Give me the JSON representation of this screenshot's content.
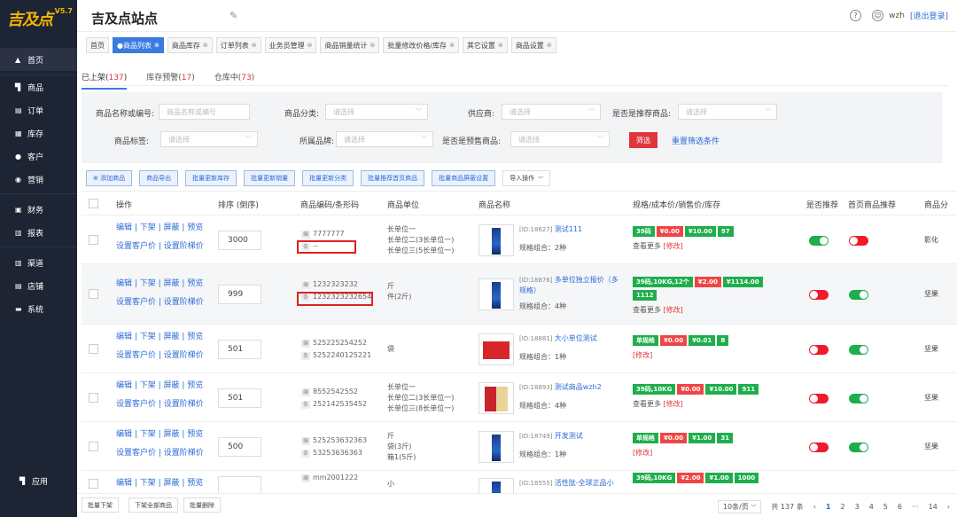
{
  "logo": {
    "text": "吉及点",
    "version": "V5.7"
  },
  "sidebar": {
    "group1": [
      {
        "icon": "home-icon",
        "glyph": "▲",
        "label": "首页"
      }
    ],
    "group2": [
      {
        "icon": "cart-icon",
        "glyph": "▜",
        "label": "商品"
      },
      {
        "icon": "order-icon",
        "glyph": "▤",
        "label": "订单"
      },
      {
        "icon": "stock-icon",
        "glyph": "▦",
        "label": "库存"
      },
      {
        "icon": "customer-icon",
        "glyph": "●",
        "label": "客户"
      },
      {
        "icon": "marketing-icon",
        "glyph": "◉",
        "label": "营销"
      }
    ],
    "group3": [
      {
        "icon": "finance-icon",
        "glyph": "▣",
        "label": "财务"
      },
      {
        "icon": "report-icon",
        "glyph": "▥",
        "label": "报表"
      }
    ],
    "group4": [
      {
        "icon": "channel-icon",
        "glyph": "▥",
        "label": "渠道"
      },
      {
        "icon": "shop-icon",
        "glyph": "▤",
        "label": "店铺"
      },
      {
        "icon": "system-icon",
        "glyph": "▬",
        "label": "系统"
      }
    ],
    "app": {
      "icon": "app-cart-icon",
      "glyph": "▜",
      "label": "应用"
    }
  },
  "header": {
    "title": "吉及点站点",
    "help": "?",
    "user": "wzh",
    "logout": "[退出登录]"
  },
  "tabs": [
    "首页",
    "商品列表",
    "商品库存",
    "订单列表",
    "业务员管理",
    "商品销量统计",
    "批量修改价格/库存",
    "其它设置",
    "商品设置"
  ],
  "status_tabs": [
    {
      "label": "已上架(",
      "count": "137",
      "end": ")"
    },
    {
      "label": "库存预警(",
      "count": "17",
      "end": ")"
    },
    {
      "label": "仓库中(",
      "count": "73",
      "end": ")"
    }
  ],
  "filter": {
    "name_label": "商品名称或编号:",
    "name_ph": "商品名称或编号",
    "cat_label": "商品分类:",
    "cat_ph": "请选择",
    "sup_label": "供应商:",
    "sup_ph": "请选择",
    "rec_label": "是否是推荐商品:",
    "rec_ph": "请选择",
    "tag_label": "商品标签:",
    "tag_ph": "请选择",
    "brand_label": "所属品牌:",
    "brand_ph": "请选择",
    "pre_label": "是否是预售商品:",
    "pre_ph": "请选择",
    "search": "筛选",
    "reset": "重置筛选条件"
  },
  "actions": [
    "添加商品",
    "商品导出",
    "批量更新库存",
    "批量更新销量",
    "批量更新分类",
    "批量推荐首页商品",
    "批量商品屏蔽设置",
    "导入操作"
  ],
  "columns": [
    "操作",
    "排序 (倒序)",
    "商品编码/条形码",
    "商品单位",
    "商品名称",
    "规格/成本价/销售价/库存",
    "是否推荐",
    "首页商品推荐",
    "商品分"
  ],
  "ops": {
    "line1": "编辑 | 下架 | 屏蔽 | 预览",
    "line2": "设置客户价 | 设置阶梯价"
  },
  "rows": [
    {
      "sort": "3000",
      "code": "7777777",
      "barcode": "--",
      "units": [
        "长单位一",
        "长单位二(3长单位一)",
        "长单位三(5长单位一)"
      ],
      "id": "[ID:18627]",
      "name": "测试111",
      "spec_count": "规格组合：2种",
      "pills": [
        [
          "39码",
          "g"
        ],
        [
          "¥0.00",
          "r"
        ],
        [
          "¥10.00",
          "g"
        ],
        [
          "97",
          "g"
        ]
      ],
      "more": "查看更多",
      "modify": "修改",
      "rec": true,
      "home": false,
      "cat": "影化"
    },
    {
      "sort": "999",
      "code": "1232323232",
      "barcode": "1232323232654",
      "units": [
        "斤",
        "件(2斤)"
      ],
      "id": "[ID:18876]",
      "name": "多单位独立报价（多规格）",
      "spec_count": "规格组合：4种",
      "pills": [
        [
          "39码,10KG,12个",
          "g"
        ],
        [
          "¥2.00",
          "r"
        ],
        [
          "¥1114.00",
          "g"
        ],
        [
          "1112",
          "g"
        ]
      ],
      "more": "查看更多",
      "modify": "修改",
      "rec": false,
      "home": true,
      "cat": "坚果"
    },
    {
      "sort": "501",
      "code": "525225254252",
      "barcode": "5252240125221",
      "units": [
        "袋"
      ],
      "id": "[ID:18881]",
      "name": "大小单位测试",
      "spec_count": "规格组合：1种",
      "pills": [
        [
          "单规格",
          "g"
        ],
        [
          "¥0.00",
          "r"
        ],
        [
          "¥0.01",
          "g"
        ],
        [
          "8",
          "g"
        ]
      ],
      "more": "",
      "modify": "修改",
      "rec": false,
      "home": true,
      "cat": "坚果"
    },
    {
      "sort": "501",
      "code": "8552542552",
      "barcode": "252142535452",
      "units": [
        "长单位一",
        "长单位二(3长单位一)",
        "长单位三(8长单位一)"
      ],
      "id": "[ID:18893]",
      "name": "测试商品wzh2",
      "spec_count": "规格组合：4种",
      "pills": [
        [
          "39码,10KG",
          "g"
        ],
        [
          "¥0.00",
          "r"
        ],
        [
          "¥10.00",
          "g"
        ],
        [
          "911",
          "g"
        ]
      ],
      "more": "查看更多",
      "modify": "修改",
      "rec": false,
      "home": true,
      "cat": "坚果"
    },
    {
      "sort": "500",
      "code": "525253632363",
      "barcode": "53253636363",
      "units": [
        "斤",
        "袋(3斤)",
        "箱1(5斤)"
      ],
      "id": "[ID:18749]",
      "name": "开发测试",
      "spec_count": "规格组合：1种",
      "pills": [
        [
          "单规格",
          "g"
        ],
        [
          "¥0.00",
          "r"
        ],
        [
          "¥1.00",
          "g"
        ],
        [
          "31",
          "g"
        ]
      ],
      "more": "",
      "modify": "修改",
      "rec": false,
      "home": true,
      "cat": "坚果"
    },
    {
      "sort": "",
      "code": "mm2001222",
      "barcode": "",
      "units": [
        "小"
      ],
      "id": "[ID:18555]",
      "name": "活性肽-全球正品小",
      "spec_count": "",
      "pills": [
        [
          "39码,10KG",
          "g"
        ],
        [
          "¥2.00",
          "r"
        ],
        [
          "¥1.00",
          "g"
        ],
        [
          "1000",
          "g"
        ]
      ],
      "more": "",
      "modify": "",
      "rec": false,
      "home": false,
      "cat": ""
    }
  ],
  "labels": {
    "code_tag": "编",
    "bar_tag": "条"
  },
  "footer": {
    "b1": "批量下架",
    "b2": "下架全部商品",
    "b3": "批量删除",
    "page_size": "10条/页",
    "total": "共 137 条",
    "pages": [
      "1",
      "2",
      "3",
      "4",
      "5",
      "6",
      "···",
      "14"
    ]
  }
}
